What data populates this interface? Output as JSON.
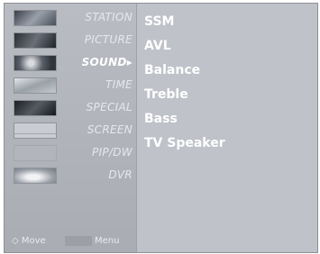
{
  "menu": {
    "items": [
      {
        "label": "STATION",
        "icon": "station-thumbnail-icon"
      },
      {
        "label": "PICTURE",
        "icon": "picture-thumbnail-icon"
      },
      {
        "label": "SOUND▸",
        "icon": "sound-thumbnail-icon"
      },
      {
        "label": "TIME",
        "icon": "time-thumbnail-icon"
      },
      {
        "label": "SPECIAL",
        "icon": "special-thumbnail-icon"
      },
      {
        "label": "SCREEN",
        "icon": "screen-thumbnail-icon"
      },
      {
        "label": "PIP/DW",
        "icon": "pip-thumbnail-icon"
      },
      {
        "label": "DVR",
        "icon": "dvr-thumbnail-icon"
      }
    ],
    "selected_index": 2
  },
  "submenu": {
    "items": [
      "SSM",
      "AVL",
      "Balance",
      "Treble",
      "Bass",
      "TV Speaker"
    ]
  },
  "footer": {
    "move_label": "◇ Move",
    "menu_label": "Menu"
  }
}
